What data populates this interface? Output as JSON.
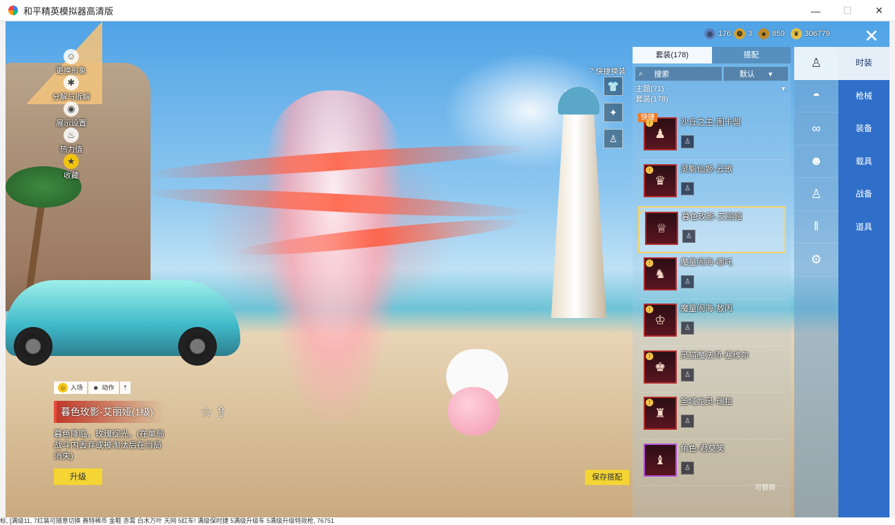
{
  "window": {
    "title": "和平精英模拟器高清版",
    "minimize": "—",
    "maximize": "☐",
    "close": "✕"
  },
  "left_menu": [
    {
      "label": "更换形象",
      "icon": "person-icon"
    },
    {
      "label": "分解与拆解",
      "icon": "gear-icon"
    },
    {
      "label": "展示设置",
      "icon": "eye-icon"
    },
    {
      "label": "热力值",
      "icon": "flame-icon"
    },
    {
      "label": "收藏",
      "icon": "badge-icon"
    }
  ],
  "currencies": [
    {
      "value": "176",
      "color": "#5b7fbf",
      "icon": "globe-coin-icon"
    },
    {
      "value": "3",
      "color": "#d6a22c",
      "icon": "medal-coin-icon"
    },
    {
      "value": "859",
      "color": "#c08a2a",
      "icon": "bronze-coin-icon"
    },
    {
      "value": "306779",
      "color": "#e6c24a",
      "icon": "gold-coin-icon"
    }
  ],
  "quick_change": {
    "label": "快捷换装"
  },
  "panel": {
    "tabs": [
      {
        "label": "套装(178)",
        "active": true
      },
      {
        "label": "搭配",
        "active": false
      }
    ],
    "search": {
      "label": "搜索"
    },
    "sort": {
      "label": "默认"
    },
    "filter_theme": "主题(71)",
    "filter_suit": "套装(178)",
    "quick_badge": "快捷",
    "items": [
      {
        "name": "沙丘之主-图卡盟",
        "selected": false,
        "frame": "red",
        "glyph": "♟"
      },
      {
        "name": "灵駒仙姬-云歌",
        "selected": false,
        "frame": "red",
        "glyph": "♛"
      },
      {
        "name": "暮色玫影-艾丽娅",
        "selected": true,
        "frame": "red",
        "glyph": "♕"
      },
      {
        "name": "魔童闹海-哪吒",
        "selected": false,
        "frame": "red",
        "glyph": "♞"
      },
      {
        "name": "魔童闹海-敖丙",
        "selected": false,
        "frame": "red",
        "glyph": "♔"
      },
      {
        "name": "灵猫魔法师-塞维尔",
        "selected": false,
        "frame": "red",
        "glyph": "♚"
      },
      {
        "name": "圣域龙灵-瑞拉",
        "selected": false,
        "frame": "red",
        "glyph": "♜"
      },
      {
        "name": "角色-君莫笑",
        "selected": false,
        "frame": "purple",
        "glyph": "♝"
      }
    ],
    "more": "可替换"
  },
  "categories": [
    "character-icon",
    "hat-icon",
    "glasses-icon",
    "mask-icon",
    "outfit-icon",
    "pants-icon",
    "shoes-icon"
  ],
  "right_nav": [
    {
      "label": "时装",
      "active": true
    },
    {
      "label": "枪械",
      "active": false
    },
    {
      "label": "装备",
      "active": false
    },
    {
      "label": "载具",
      "active": false
    },
    {
      "label": "战备",
      "active": false
    },
    {
      "label": "道具",
      "active": false
    }
  ],
  "detail": {
    "enter_tab": "入场",
    "action_tab": "动作",
    "name": "暮色玫影-艾丽娅(1级)",
    "description": "暮色降临，玫瑰绽光。(在单局战斗内丢弃或被淘汰后在当局消失)",
    "upgrade": "升级",
    "save": "保存搭配"
  },
  "bottom_text": "标, [满级11, 7红装可随意切换 赛特稀币 金鞋 赤霄 白木万叶 天网 5红车! 满级保时捷 5满级升级车 5满级升级特效枪, 76751"
}
